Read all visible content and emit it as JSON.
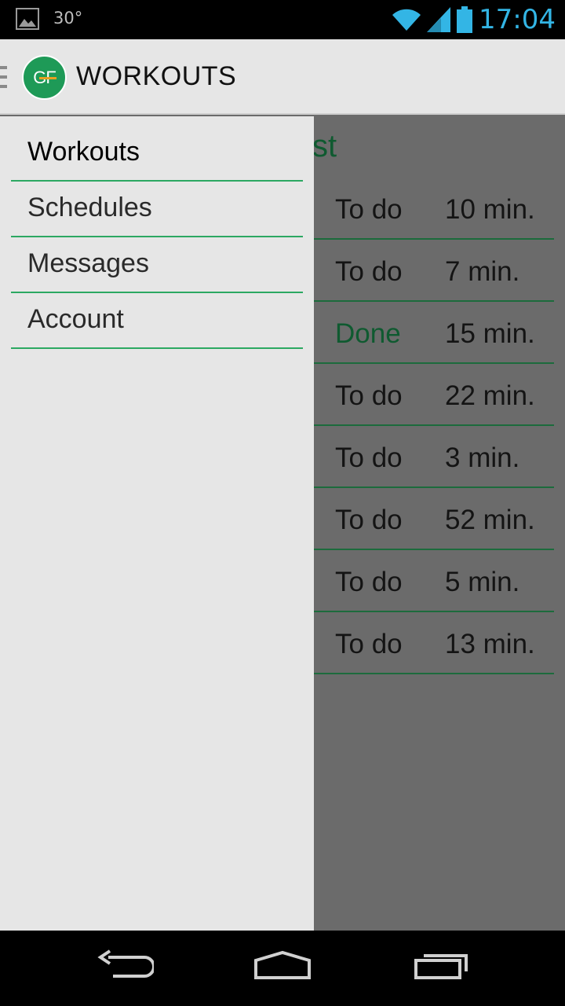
{
  "status_bar": {
    "temperature": "30°",
    "time": "17:04",
    "icons": [
      "image-notification-icon",
      "wifi-icon",
      "signal-icon",
      "battery-icon"
    ]
  },
  "action_bar": {
    "title": "WORKOUTS",
    "logo_text": "GF"
  },
  "drawer": {
    "items": [
      {
        "label": "Workouts",
        "active": true
      },
      {
        "label": "Schedules",
        "active": false
      },
      {
        "label": "Messages",
        "active": false
      },
      {
        "label": "Account",
        "active": false
      }
    ]
  },
  "content": {
    "heading_fragment": "st",
    "rows": [
      {
        "status": "To do",
        "duration": "10 min."
      },
      {
        "status": "To do",
        "duration": "7 min."
      },
      {
        "status": "Done",
        "duration": "15 min."
      },
      {
        "status": "To do",
        "duration": "22 min."
      },
      {
        "status": "To do",
        "duration": "3 min."
      },
      {
        "status": "To do",
        "duration": "52 min."
      },
      {
        "status": "To do",
        "duration": "5 min."
      },
      {
        "status": "To do",
        "duration": "13 min."
      }
    ]
  },
  "nav_bar": {
    "buttons": [
      "back-icon",
      "home-icon",
      "recent-apps-icon"
    ]
  },
  "colors": {
    "accent_green": "#2ca862",
    "dark_green": "#0f5a30",
    "holo_blue": "#33b5e5",
    "drawer_bg": "#e6e6e6"
  }
}
